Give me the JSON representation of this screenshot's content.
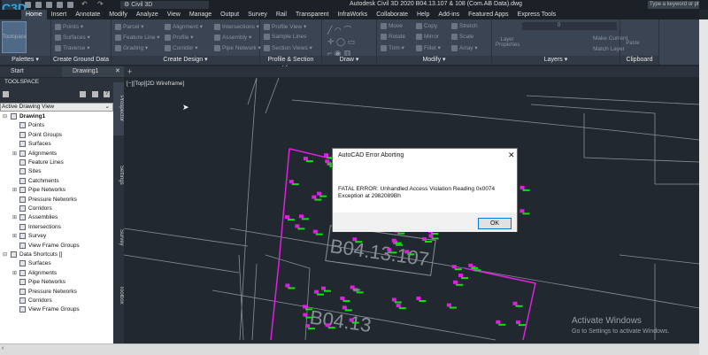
{
  "app": {
    "title": "Autodesk Civil 3D 2020    B04.13.107 & 108 (Com.AB Data).dwg",
    "workspace": "Civil 3D",
    "search_placeholder": "Type a keyword or phrase",
    "logo": "C3D"
  },
  "ribbon_tabs": [
    "Home",
    "Insert",
    "Annotate",
    "Modify",
    "Analyze",
    "View",
    "Manage",
    "Output",
    "Survey",
    "Rail",
    "Transparent",
    "InfraWorks",
    "Collaborate",
    "Help",
    "Add-ins",
    "Featured Apps",
    "Express Tools"
  ],
  "panels": {
    "palettes": {
      "label": "Palettes ▾",
      "toolspace": "Toolspace"
    },
    "ground": {
      "label": "Create Ground Data ▾",
      "buttons": [
        "Points ▾",
        "Surfaces ▾",
        "Traverse ▾"
      ]
    },
    "design": {
      "label": "Create Design ▾",
      "buttons": [
        "Parcel ▾",
        "Feature Line ▾",
        "Grading ▾",
        "Alignment ▾",
        "Profile ▾",
        "Corridor ▾",
        "Intersections ▾",
        "Assembly ▾",
        "Pipe Network ▾"
      ]
    },
    "views": {
      "label": "Profile & Section Views",
      "buttons": [
        "Profile View ▾",
        "Sample Lines",
        "Section Views ▾"
      ]
    },
    "draw": {
      "label": "Draw ▾"
    },
    "modify": {
      "label": "Modify ▾",
      "buttons": [
        "Move",
        "Rotate",
        "Trim ▾",
        "Copy",
        "Mirror",
        "Fillet ▾",
        "Stretch",
        "Scale",
        "Array ▾"
      ]
    },
    "layers": {
      "label": "Layers ▾",
      "layer_properties": "Layer Properties",
      "current_layer": "0",
      "buttons": [
        "Make Current",
        "Match Layer"
      ]
    },
    "clipboard": {
      "label": "Clipboard",
      "paste": "Paste"
    }
  },
  "file_tabs": [
    "Start",
    "Drawing1"
  ],
  "toolspace": {
    "title": "TOOLSPACE",
    "view": "Active Drawing View",
    "tree": [
      {
        "label": "Drawing1",
        "level": 0,
        "expander": "⊟",
        "bold": true
      },
      {
        "label": "Points",
        "level": 1
      },
      {
        "label": "Point Groups",
        "level": 1
      },
      {
        "label": "Surfaces",
        "level": 1
      },
      {
        "label": "Alignments",
        "level": 1,
        "expander": "⊞"
      },
      {
        "label": "Feature Lines",
        "level": 1
      },
      {
        "label": "Sites",
        "level": 1
      },
      {
        "label": "Catchments",
        "level": 1
      },
      {
        "label": "Pipe Networks",
        "level": 1,
        "expander": "⊞"
      },
      {
        "label": "Pressure Networks",
        "level": 1
      },
      {
        "label": "Corridors",
        "level": 1
      },
      {
        "label": "Assemblies",
        "level": 1,
        "expander": "⊞"
      },
      {
        "label": "Intersections",
        "level": 1
      },
      {
        "label": "Survey",
        "level": 1,
        "expander": "⊞"
      },
      {
        "label": "View Frame Groups",
        "level": 1
      },
      {
        "label": "Data Shortcuts []",
        "level": 0,
        "expander": "⊟"
      },
      {
        "label": "Surfaces",
        "level": 1
      },
      {
        "label": "Alignments",
        "level": 1,
        "expander": "⊞"
      },
      {
        "label": "Pipe Networks",
        "level": 1
      },
      {
        "label": "Pressure Networks",
        "level": 1
      },
      {
        "label": "Corridors",
        "level": 1
      },
      {
        "label": "View Frame Groups",
        "level": 1
      }
    ],
    "side_tabs": [
      "Prospector",
      "Settings",
      "Survey",
      "Toolbox"
    ]
  },
  "viewport": {
    "label": "[−][Top][2D Wireframe]",
    "parcel_labels": [
      "B04.13.107",
      "B04.13"
    ]
  },
  "dialog": {
    "title": "AutoCAD Error Aborting",
    "close": "✕",
    "message": "FATAL ERROR:  Unhandled Access Violation Reading 0x0074 Exception at 2982089Bh",
    "ok": "OK"
  },
  "watermark": {
    "line1": "Activate Windows",
    "line2": "Go to Settings to activate Windows."
  },
  "colors": {
    "parcel": "#e020e0",
    "points": "#10e010",
    "ribbon": "#3b4453"
  }
}
